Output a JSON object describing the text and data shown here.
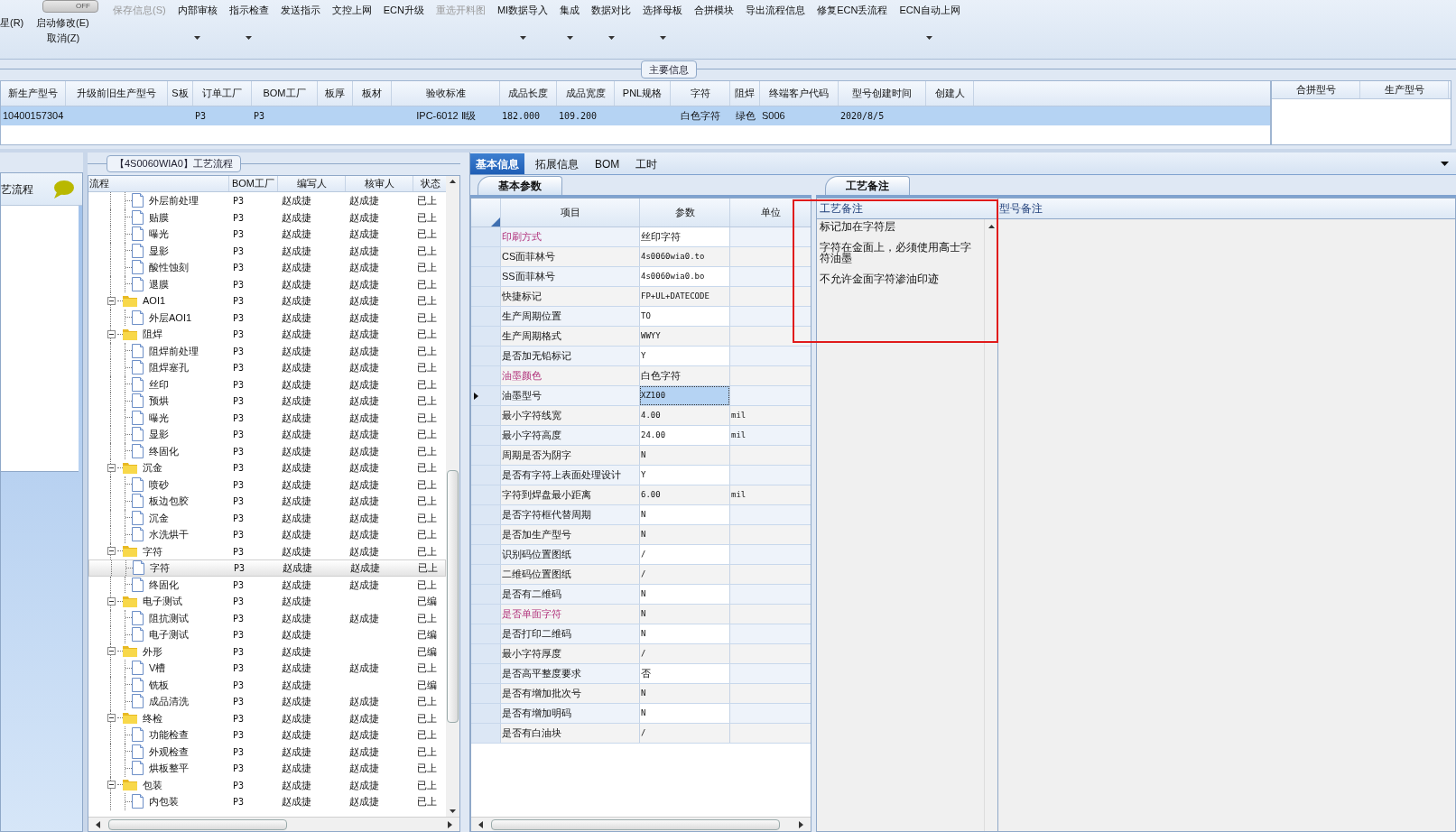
{
  "toolbar": {
    "toggle": {
      "label": "OFF"
    },
    "left_actions": [
      {
        "label": "星(R)"
      },
      {
        "label": "启动修改(E)"
      },
      {
        "label": "取消(Z)"
      }
    ],
    "buttons": [
      {
        "label": "保存信息(S)",
        "disabled": true,
        "dropdown": false
      },
      {
        "label": "内部审核",
        "disabled": false,
        "dropdown": true
      },
      {
        "label": "指示检查",
        "disabled": false,
        "dropdown": true
      },
      {
        "label": "发送指示",
        "disabled": false,
        "dropdown": false
      },
      {
        "label": "文控上网",
        "disabled": false,
        "dropdown": false
      },
      {
        "label": "ECN升级",
        "disabled": false,
        "dropdown": false
      },
      {
        "label": "重选开料图",
        "disabled": true,
        "dropdown": false
      },
      {
        "label": "MI数据导入",
        "disabled": false,
        "dropdown": true
      },
      {
        "label": "集成",
        "disabled": false,
        "dropdown": true
      },
      {
        "label": "数据对比",
        "disabled": false,
        "dropdown": true
      },
      {
        "label": "选择母板",
        "disabled": false,
        "dropdown": true
      },
      {
        "label": "合拼模块",
        "disabled": false,
        "dropdown": false
      },
      {
        "label": "导出流程信息",
        "disabled": false,
        "dropdown": false
      },
      {
        "label": "修复ECN丢流程",
        "disabled": false,
        "dropdown": false
      },
      {
        "label": "ECN自动上网",
        "disabled": false,
        "dropdown": true
      }
    ]
  },
  "main_info": {
    "title": "主要信息",
    "columns": [
      "新生产型号",
      "升级前旧生产型号",
      "S板",
      "订单工厂",
      "BOM工厂",
      "板厚",
      "板材",
      "验收标准",
      "成品长度",
      "成品宽度",
      "PNL规格",
      "字符",
      "阻焊",
      "终端客户代码",
      "型号创建时间",
      "创建人"
    ],
    "rows": [
      {
        "selected": true,
        "cells": [
          "10400157304",
          "",
          "",
          "P3",
          "P3",
          "",
          "",
          "IPC-6012 Ⅱ级",
          "182.000",
          "109.200",
          "",
          "白色字符",
          "绿色",
          "S006",
          "2020/8/5",
          ""
        ]
      }
    ],
    "side_columns": [
      "合拼型号",
      "生产型号"
    ]
  },
  "side_panel": {
    "title": "艺流程"
  },
  "process_tree": {
    "title": "【4S0060WIA0】工艺流程",
    "columns": [
      "流程",
      "BOM工厂",
      "编写人",
      "核审人",
      "状态"
    ],
    "nodes": [
      {
        "kind": "step",
        "name": "外层前处理",
        "bom": "P3",
        "writer": "赵成捷",
        "reviewer": "赵成捷",
        "status": "已上",
        "selected": false
      },
      {
        "kind": "step",
        "name": "贴膜",
        "bom": "P3",
        "writer": "赵成捷",
        "reviewer": "赵成捷",
        "status": "已上",
        "selected": false
      },
      {
        "kind": "step",
        "name": "曝光",
        "bom": "P3",
        "writer": "赵成捷",
        "reviewer": "赵成捷",
        "status": "已上",
        "selected": false
      },
      {
        "kind": "step",
        "name": "显影",
        "bom": "P3",
        "writer": "赵成捷",
        "reviewer": "赵成捷",
        "status": "已上",
        "selected": false
      },
      {
        "kind": "step",
        "name": "酸性蚀刻",
        "bom": "P3",
        "writer": "赵成捷",
        "reviewer": "赵成捷",
        "status": "已上",
        "selected": false
      },
      {
        "kind": "step",
        "name": "退膜",
        "bom": "P3",
        "writer": "赵成捷",
        "reviewer": "赵成捷",
        "status": "已上",
        "selected": false
      },
      {
        "kind": "group",
        "name": "AOI1",
        "bom": "P3",
        "writer": "赵成捷",
        "reviewer": "赵成捷",
        "status": "已上",
        "selected": false,
        "expanded": true,
        "children": [
          {
            "kind": "step",
            "name": "外层AOI1",
            "bom": "P3",
            "writer": "赵成捷",
            "reviewer": "赵成捷",
            "status": "已上",
            "selected": false
          }
        ]
      },
      {
        "kind": "group",
        "name": "阻焊",
        "bom": "P3",
        "writer": "赵成捷",
        "reviewer": "赵成捷",
        "status": "已上",
        "selected": false,
        "expanded": true,
        "children": [
          {
            "kind": "step",
            "name": "阻焊前处理",
            "bom": "P3",
            "writer": "赵成捷",
            "reviewer": "赵成捷",
            "status": "已上",
            "selected": false
          },
          {
            "kind": "step",
            "name": "阻焊塞孔",
            "bom": "P3",
            "writer": "赵成捷",
            "reviewer": "赵成捷",
            "status": "已上",
            "selected": false
          },
          {
            "kind": "step",
            "name": "丝印",
            "bom": "P3",
            "writer": "赵成捷",
            "reviewer": "赵成捷",
            "status": "已上",
            "selected": false
          },
          {
            "kind": "step",
            "name": "预烘",
            "bom": "P3",
            "writer": "赵成捷",
            "reviewer": "赵成捷",
            "status": "已上",
            "selected": false
          },
          {
            "kind": "step",
            "name": "曝光",
            "bom": "P3",
            "writer": "赵成捷",
            "reviewer": "赵成捷",
            "status": "已上",
            "selected": false
          },
          {
            "kind": "step",
            "name": "显影",
            "bom": "P3",
            "writer": "赵成捷",
            "reviewer": "赵成捷",
            "status": "已上",
            "selected": false
          },
          {
            "kind": "step",
            "name": "终固化",
            "bom": "P3",
            "writer": "赵成捷",
            "reviewer": "赵成捷",
            "status": "已上",
            "selected": false
          }
        ]
      },
      {
        "kind": "group",
        "name": "沉金",
        "bom": "P3",
        "writer": "赵成捷",
        "reviewer": "赵成捷",
        "status": "已上",
        "selected": false,
        "expanded": true,
        "children": [
          {
            "kind": "step",
            "name": "喷砂",
            "bom": "P3",
            "writer": "赵成捷",
            "reviewer": "赵成捷",
            "status": "已上",
            "selected": false
          },
          {
            "kind": "step",
            "name": "板边包胶",
            "bom": "P3",
            "writer": "赵成捷",
            "reviewer": "赵成捷",
            "status": "已上",
            "selected": false
          },
          {
            "kind": "step",
            "name": "沉金",
            "bom": "P3",
            "writer": "赵成捷",
            "reviewer": "赵成捷",
            "status": "已上",
            "selected": false
          },
          {
            "kind": "step",
            "name": "水洗烘干",
            "bom": "P3",
            "writer": "赵成捷",
            "reviewer": "赵成捷",
            "status": "已上",
            "selected": false
          }
        ]
      },
      {
        "kind": "group",
        "name": "字符",
        "bom": "P3",
        "writer": "赵成捷",
        "reviewer": "赵成捷",
        "status": "已上",
        "selected": false,
        "expanded": true,
        "children": [
          {
            "kind": "step",
            "name": "字符",
            "bom": "P3",
            "writer": "赵成捷",
            "reviewer": "赵成捷",
            "status": "已上",
            "selected": true
          },
          {
            "kind": "step",
            "name": "终固化",
            "bom": "P3",
            "writer": "赵成捷",
            "reviewer": "赵成捷",
            "status": "已上",
            "selected": false
          }
        ]
      },
      {
        "kind": "group",
        "name": "电子测试",
        "bom": "P3",
        "writer": "赵成捷",
        "status": "已编",
        "selected": false,
        "expanded": true,
        "children": [
          {
            "kind": "step",
            "name": "阻抗测试",
            "bom": "P3",
            "writer": "赵成捷",
            "reviewer": "赵成捷",
            "status": "已上",
            "selected": false
          },
          {
            "kind": "step",
            "name": "电子测试",
            "bom": "P3",
            "writer": "赵成捷",
            "status": "已编",
            "selected": false
          }
        ]
      },
      {
        "kind": "group",
        "name": "外形",
        "bom": "P3",
        "writer": "赵成捷",
        "status": "已编",
        "selected": false,
        "expanded": true,
        "children": [
          {
            "kind": "step",
            "name": "V槽",
            "bom": "P3",
            "writer": "赵成捷",
            "reviewer": "赵成捷",
            "status": "已上",
            "selected": false
          },
          {
            "kind": "step",
            "name": "铣板",
            "bom": "P3",
            "writer": "赵成捷",
            "status": "已编",
            "selected": false
          },
          {
            "kind": "step",
            "name": "成品清洗",
            "bom": "P3",
            "writer": "赵成捷",
            "reviewer": "赵成捷",
            "status": "已上",
            "selected": false
          }
        ]
      },
      {
        "kind": "group",
        "name": "终检",
        "bom": "P3",
        "writer": "赵成捷",
        "reviewer": "赵成捷",
        "status": "已上",
        "selected": false,
        "expanded": true,
        "children": [
          {
            "kind": "step",
            "name": "功能检查",
            "bom": "P3",
            "writer": "赵成捷",
            "reviewer": "赵成捷",
            "status": "已上",
            "selected": false
          },
          {
            "kind": "step",
            "name": "外观检查",
            "bom": "P3",
            "writer": "赵成捷",
            "reviewer": "赵成捷",
            "status": "已上",
            "selected": false
          },
          {
            "kind": "step",
            "name": "烘板整平",
            "bom": "P3",
            "writer": "赵成捷",
            "reviewer": "赵成捷",
            "status": "已上",
            "selected": false
          }
        ]
      },
      {
        "kind": "group",
        "name": "包装",
        "bom": "P3",
        "writer": "赵成捷",
        "reviewer": "赵成捷",
        "status": "已上",
        "selected": false,
        "expanded": true,
        "children": [
          {
            "kind": "step",
            "name": "内包装",
            "bom": "P3",
            "writer": "赵成捷",
            "reviewer": "赵成捷",
            "status": "已上",
            "selected": false
          }
        ]
      }
    ]
  },
  "tabs": [
    {
      "label": "基本信息",
      "selected": true
    },
    {
      "label": "拓展信息",
      "selected": false
    },
    {
      "label": "BOM",
      "selected": false
    },
    {
      "label": "工时",
      "selected": false
    }
  ],
  "params": {
    "title": "基本参数",
    "columns": [
      "项目",
      "参数",
      "单位"
    ],
    "rows": [
      {
        "item": "印刷方式",
        "value": "丝印字符",
        "flagged": true,
        "selected": false
      },
      {
        "item": "CS面菲林号",
        "value": "4s0060wia0.to",
        "flagged": false,
        "selected": false
      },
      {
        "item": "SS面菲林号",
        "value": "4s0060wia0.bo",
        "flagged": false,
        "selected": false
      },
      {
        "item": "快捷标记",
        "value": "FP+UL+DATECODE",
        "flagged": false,
        "selected": false
      },
      {
        "item": "生产周期位置",
        "value": "TO",
        "flagged": false,
        "selected": false
      },
      {
        "item": "生产周期格式",
        "value": "WWYY",
        "flagged": false,
        "selected": false
      },
      {
        "item": "是否加无铅标记",
        "value": "Y",
        "flagged": false,
        "selected": false
      },
      {
        "item": "油墨颜色",
        "value": "白色字符",
        "flagged": true,
        "selected": false
      },
      {
        "item": "油墨型号",
        "value": "XZ100",
        "flagged": false,
        "selected": true
      },
      {
        "item": "最小字符线宽",
        "value": "4.00",
        "unit": "mil",
        "flagged": false,
        "selected": false
      },
      {
        "item": "最小字符高度",
        "value": "24.00",
        "unit": "mil",
        "flagged": false,
        "selected": false
      },
      {
        "item": "周期是否为阴字",
        "value": "N",
        "flagged": false,
        "selected": false
      },
      {
        "item": "是否有字符上表面处理设计",
        "value": "Y",
        "flagged": false,
        "selected": false
      },
      {
        "item": "字符到焊盘最小距离",
        "value": "6.00",
        "unit": "mil",
        "flagged": false,
        "selected": false
      },
      {
        "item": "是否字符框代替周期",
        "value": "N",
        "flagged": false,
        "selected": false
      },
      {
        "item": "是否加生产型号",
        "value": "N",
        "flagged": false,
        "selected": false
      },
      {
        "item": "识别码位置图纸",
        "value": "/",
        "flagged": false,
        "selected": false
      },
      {
        "item": "二维码位置图纸",
        "value": "/",
        "flagged": false,
        "selected": false
      },
      {
        "item": "是否有二维码",
        "value": "N",
        "flagged": false,
        "selected": false
      },
      {
        "item": "是否单面字符",
        "value": "N",
        "flagged": true,
        "selected": false
      },
      {
        "item": "是否打印二维码",
        "value": "N",
        "flagged": false,
        "selected": false
      },
      {
        "item": "最小字符厚度",
        "value": "/",
        "flagged": false,
        "selected": false
      },
      {
        "item": "是否高平整度要求",
        "value": "否",
        "flagged": false,
        "selected": false
      },
      {
        "item": "是否有增加批次号",
        "value": "N",
        "flagged": false,
        "selected": false
      },
      {
        "item": "是否有增加明码",
        "value": "N",
        "flagged": false,
        "selected": false
      },
      {
        "item": "是否有白油块",
        "value": "/",
        "flagged": false,
        "selected": false
      }
    ]
  },
  "notes": {
    "title": "工艺备注",
    "columns": [
      "工艺备注",
      "型号备注"
    ],
    "lines": [
      "标记加在字符层",
      "字符在金面上，必须使用高士字符油墨",
      "不允许金面字符渗油印迹"
    ]
  }
}
